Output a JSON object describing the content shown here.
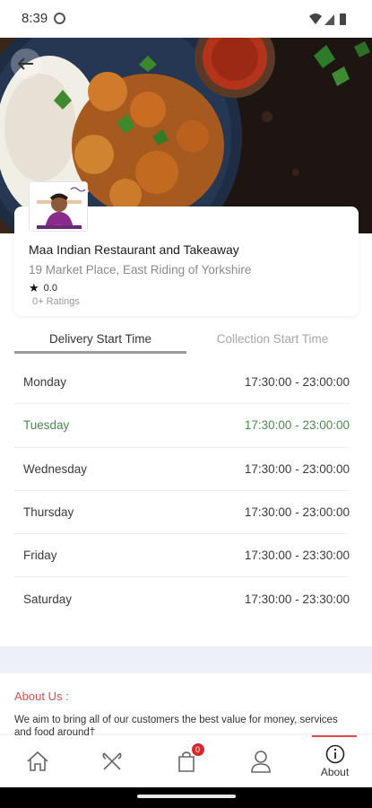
{
  "status_bar": {
    "time": "8:39"
  },
  "restaurant": {
    "name": "Maa Indian Restaurant and Takeaway",
    "address": "19 Market Place, East Riding of Yorkshire",
    "rating": "0.0",
    "ratings_count": "0+ Ratings"
  },
  "tabs": {
    "delivery": "Delivery Start Time",
    "collection": "Collection Start Time",
    "selected": "delivery"
  },
  "hours": [
    {
      "day": "Monday",
      "time": "17:30:00 - 23:00:00",
      "active": false
    },
    {
      "day": "Tuesday",
      "time": "17:30:00 - 23:00:00",
      "active": true
    },
    {
      "day": "Wednesday",
      "time": "17:30:00 - 23:00:00",
      "active": false
    },
    {
      "day": "Thursday",
      "time": "17:30:00 - 23:00:00",
      "active": false
    },
    {
      "day": "Friday",
      "time": "17:30:00 - 23:30:00",
      "active": false
    },
    {
      "day": "Saturday",
      "time": "17:30:00 - 23:30:00",
      "active": false
    }
  ],
  "about": {
    "title": "About Us :",
    "text": "We aim to bring all of our customers the best value for money, services and food around†"
  },
  "bottom_nav": {
    "items": [
      {
        "name": "home",
        "icon": "home-icon",
        "label": ""
      },
      {
        "name": "menu",
        "icon": "fork-knife-icon",
        "label": ""
      },
      {
        "name": "basket",
        "icon": "shopping-bag-icon",
        "label": "",
        "badge": "0"
      },
      {
        "name": "account",
        "icon": "user-icon",
        "label": ""
      },
      {
        "name": "about",
        "icon": "info-icon",
        "label": "About"
      }
    ],
    "active": "about"
  },
  "colors": {
    "accent_red": "#e14a4a",
    "active_day_green": "#4a8a4f",
    "badge_red": "#d62828"
  }
}
